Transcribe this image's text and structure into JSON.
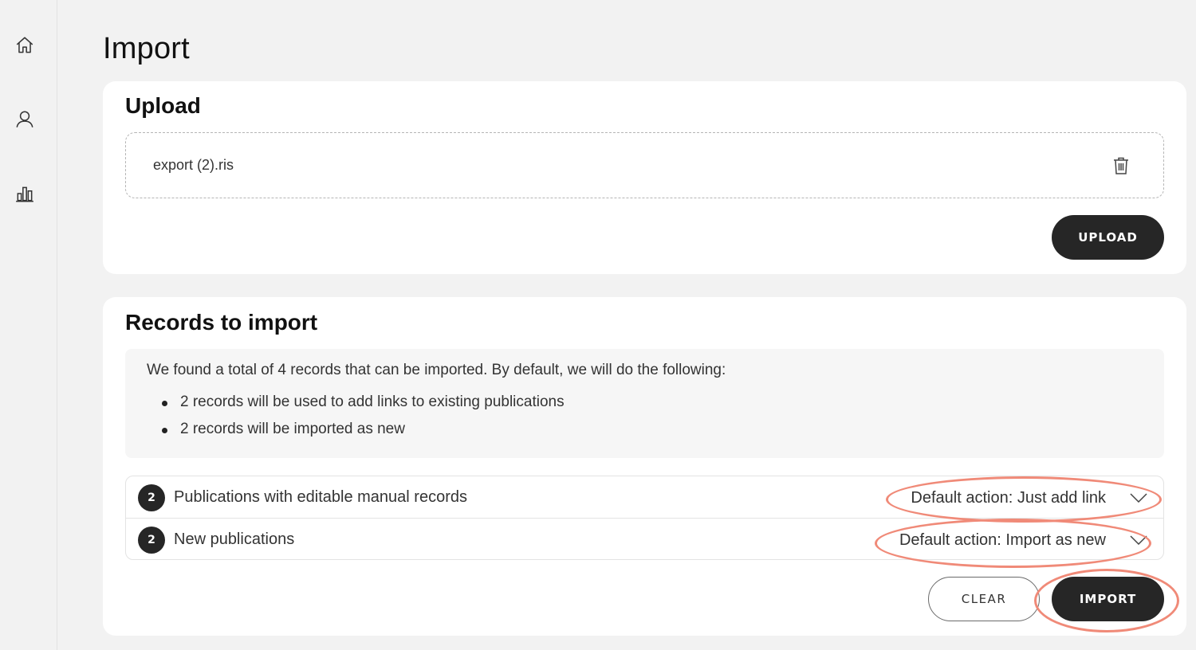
{
  "sidebar": {
    "items": [
      {
        "name": "home",
        "icon": "home-icon"
      },
      {
        "name": "profile",
        "icon": "user-icon"
      },
      {
        "name": "statistics",
        "icon": "bar-chart-icon"
      }
    ]
  },
  "page": {
    "title": "Import"
  },
  "upload": {
    "title": "Upload",
    "file_name": "export (2).ris",
    "delete_icon": "trash-icon",
    "upload_label": "UPLOAD"
  },
  "records": {
    "title": "Records to import",
    "summary": "We found a total of 4 records that can be imported. By default, we will do the following:",
    "bullets": [
      "2 records will be used to add links to existing publications",
      "2 records will be imported as new"
    ],
    "groups": [
      {
        "count": "2",
        "label": "Publications with editable manual records",
        "action": "Default action: Just add link"
      },
      {
        "count": "2",
        "label": "New publications",
        "action": "Default action: Import as new"
      }
    ],
    "clear_label": "CLEAR",
    "import_label": "IMPORT"
  },
  "colors": {
    "dark_button": "#262626",
    "annotation": "#f08a78",
    "background": "#f2f2f2"
  }
}
